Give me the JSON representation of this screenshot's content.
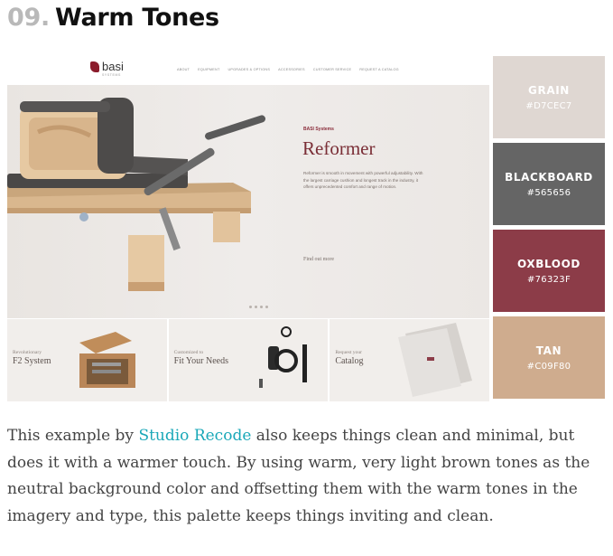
{
  "heading": {
    "number": "09.",
    "title": "Warm Tones"
  },
  "showcase": {
    "logo": {
      "text": "basi",
      "sub": "SYSTEMS"
    },
    "nav": [
      "ABOUT",
      "EQUIPMENT",
      "UPGRADES & OPTIONS",
      "ACCESSORIES",
      "CUSTOMER SERVICE",
      "REQUEST A CATALOG"
    ],
    "hero": {
      "brand": "BASI Systems",
      "title": "Reformer",
      "description": "Reformer is smooth in movement with powerful adjustability. With the largest carriage cushion and longest track in the industry, it offers unprecedented comfort and range of motion.",
      "link": "Find out more"
    },
    "tiles": [
      {
        "small": "Revolutionary",
        "big": "F2 System"
      },
      {
        "small": "Customized to",
        "big": "Fit Your Needs"
      },
      {
        "small": "Request your",
        "big": "Catalog"
      }
    ]
  },
  "palette": [
    {
      "name": "GRAIN",
      "hex": "#D7CEC7",
      "color": "#dfd7d2",
      "text_color": "#ffffff"
    },
    {
      "name": "BLACKBOARD",
      "hex": "#565656",
      "color": "#656565",
      "text_color": "#ffffff"
    },
    {
      "name": "OXBLOOD",
      "hex": "#76323F",
      "color": "#8c3c48",
      "text_color": "#ffffff"
    },
    {
      "name": "TAN",
      "hex": "#C09F80",
      "color": "#cfac8e",
      "text_color": "#ffffff"
    }
  ],
  "paragraph": {
    "before": "This example by ",
    "link": "Studio Recode",
    "after": " also keeps things clean and minimal, but does it with a warmer touch. By using warm, very light brown tones as the neutral background color and offsetting them with the warm tones in the imagery and type, this palette keeps things inviting and clean."
  }
}
